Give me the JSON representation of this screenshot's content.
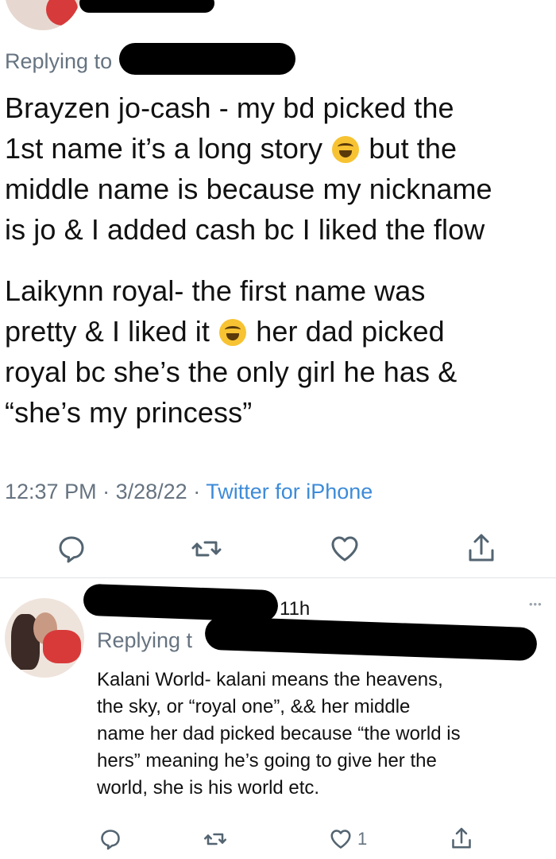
{
  "tweet1": {
    "replying_label": "Replying to",
    "paragraph1": {
      "line1": "Brayzen jo-cash - my bd picked the",
      "line2_a": "1st name it’s a long story",
      "line2_b": "but the",
      "line3": "middle name is because my nickname",
      "line4": "is jo & I added cash bc I liked the flow"
    },
    "paragraph2": {
      "line1": "Laikynn royal- the first name was",
      "line2_a": "pretty & I liked it",
      "line2_b": "her dad picked",
      "line3": "royal bc she’s the only girl he has &",
      "line4": "“she’s my princess”"
    },
    "time": "12:37 PM",
    "date": "3/28/22",
    "source": "Twitter for iPhone",
    "separator": "·",
    "actions": {
      "reply_icon": "reply-icon",
      "retweet_icon": "retweet-icon",
      "like_icon": "heart-icon",
      "share_icon": "share-icon"
    }
  },
  "tweet2": {
    "time_ago": "11h",
    "more": "•••",
    "replying_label": "Replying t",
    "lines": [
      "Kalani World- kalani means the heavens,",
      "the sky, or “royal one”, &&  her middle",
      "name her dad picked because “the world is",
      "hers” meaning he’s going to give her the",
      "world, she is his world etc."
    ],
    "like_count": "1"
  },
  "colors": {
    "meta_gray": "#667380",
    "link_blue": "#3d8bd9",
    "divider": "#dfe3e6"
  }
}
